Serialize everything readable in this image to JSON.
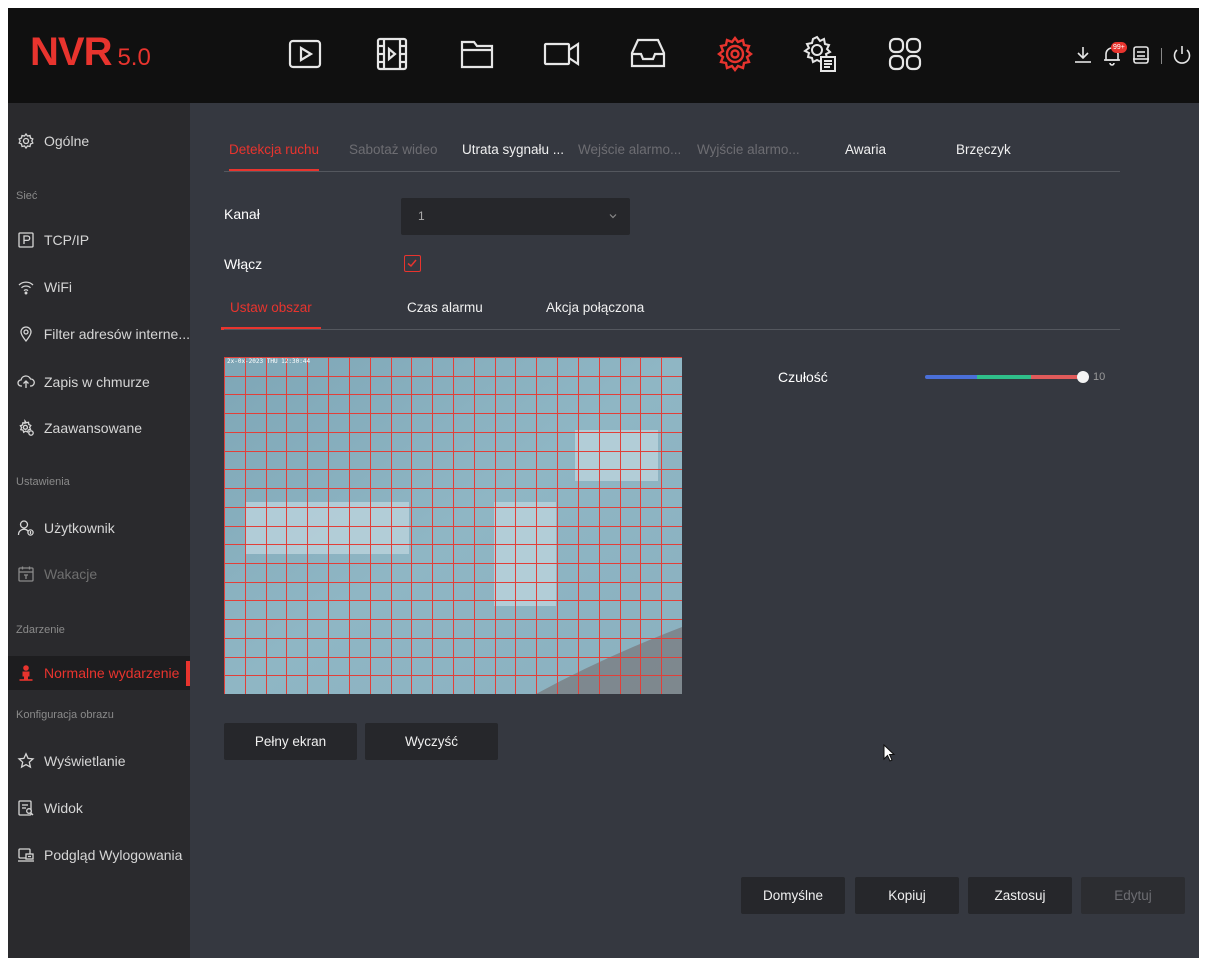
{
  "app": {
    "logo_main": "NVR",
    "logo_version": "5.0",
    "accent_color": "#e8342e"
  },
  "topbar": {
    "icons": [
      "play-icon",
      "playback-film-icon",
      "folder-icon",
      "camera-icon",
      "storage-tray-icon",
      "settings-gear-icon",
      "advanced-settings-icon",
      "apps-grid-icon"
    ],
    "active_icon": "settings-gear-icon",
    "notification_badge": "99+",
    "system_icons": [
      "download-icon",
      "alarm-bell-icon",
      "info-log-icon",
      "power-icon"
    ]
  },
  "sidebar": {
    "general": "Ogólne",
    "group_network": "Sieć",
    "tcpip": "TCP/IP",
    "wifi": "WiFi",
    "ip_filter": "Filter adresów interne...",
    "cloud": "Zapis w chmurze",
    "advanced": "Zaawansowane",
    "group_settings": "Ustawienia",
    "user": "Użytkownik",
    "holidays": "Wakacje",
    "group_event": "Zdarzenie",
    "normal_event": "Normalne wydarzenie",
    "group_image": "Konfiguracja obrazu",
    "display": "Wyświetlanie",
    "view": "Widok",
    "logout_preview": "Podgląd Wylogowania"
  },
  "tabs": {
    "motion": "Detekcja ruchu",
    "tamper": "Sabotaż wideo",
    "signal_loss": "Utrata sygnału ...",
    "alarm_in": "Wejście alarmo...",
    "alarm_out": "Wyjście alarmo...",
    "failure": "Awaria",
    "buzzer": "Brzęczyk"
  },
  "form": {
    "channel_label": "Kanał",
    "channel_value": "1",
    "enable_label": "Włącz",
    "enable_checked": true
  },
  "subtabs": {
    "area": "Ustaw obszar",
    "schedule": "Czas alarmu",
    "linkage": "Akcja połączona"
  },
  "video": {
    "osd_text": "2x-0x-2023 THU 12:30:44"
  },
  "sensitivity": {
    "label": "Czułość",
    "value": "10",
    "level_fraction": 1.0
  },
  "buttons": {
    "fullscreen": "Pełny ekran",
    "clear": "Wyczyść",
    "default": "Domyślne",
    "copy": "Kopiuj",
    "apply": "Zastosuj",
    "edit": "Edytuj"
  }
}
